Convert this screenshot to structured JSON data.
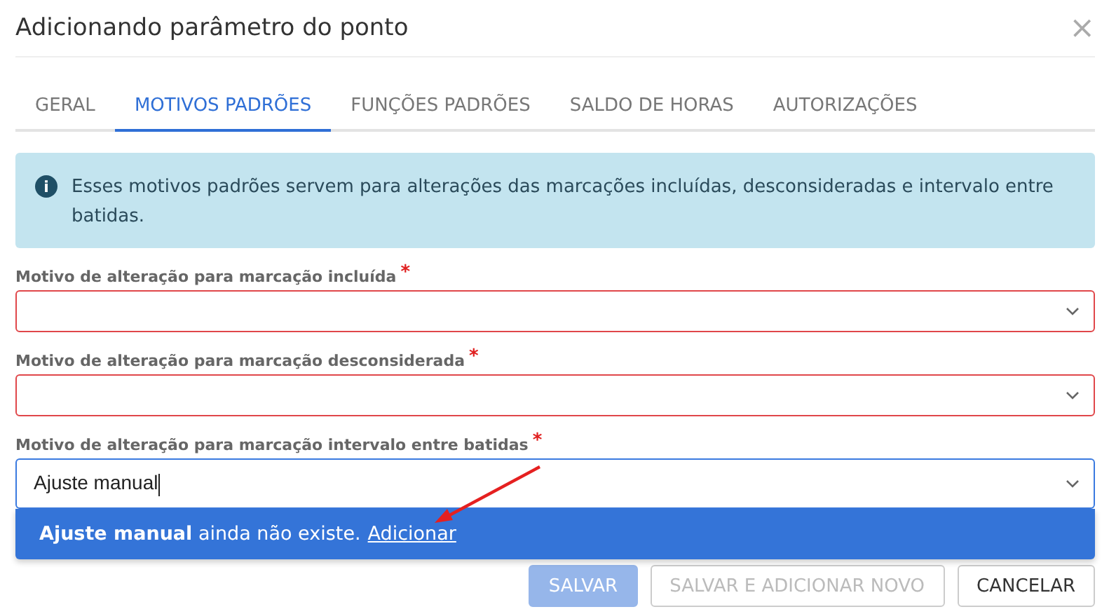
{
  "dialog": {
    "title": "Adicionando parâmetro do ponto",
    "close": "×"
  },
  "tabs": [
    {
      "label": "GERAL",
      "selected": false
    },
    {
      "label": "MOTIVOS PADRÕES",
      "selected": true
    },
    {
      "label": "FUNÇÕES PADRÕES",
      "selected": false
    },
    {
      "label": "SALDO DE HORAS",
      "selected": false
    },
    {
      "label": "AUTORIZAÇÕES",
      "selected": false
    }
  ],
  "info": {
    "icon": "i",
    "text": "Esses motivos padrões servem para alterações das marcações incluídas, desconsideradas e intervalo entre batidas."
  },
  "fields": [
    {
      "label": "Motivo de alteração para marcação incluída",
      "required": "*",
      "invalid": true,
      "focused": false
    },
    {
      "label": "Motivo de alteração para marcação desconsiderada",
      "required": "*",
      "invalid": true,
      "focused": false
    },
    {
      "label": "Motivo de alteração para marcação intervalo entre batidas",
      "required": "*",
      "invalid": false,
      "focused": true,
      "value": "Ajuste manual"
    }
  ],
  "dropdown_option": {
    "text": "**Ajuste manual** ainda não existe.",
    "link": "Adicionar"
  },
  "buttons": [
    {
      "label": "SALVAR",
      "kind": "primary",
      "disabled": true
    },
    {
      "label": "SALVAR E ADICIONAR NOVO",
      "kind": "secondary",
      "disabled": true
    },
    {
      "label": "CANCELAR",
      "kind": "secondary",
      "disabled": false
    }
  ]
}
